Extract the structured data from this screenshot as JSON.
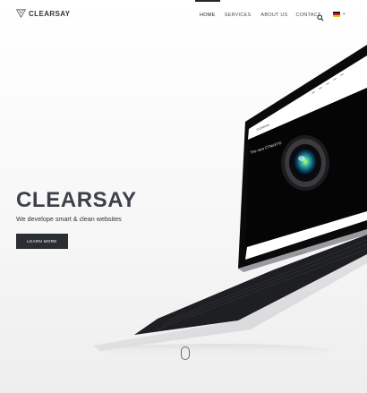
{
  "brand": {
    "name": "CLEARSAY",
    "logo_icon": "triangle-logo-icon"
  },
  "nav": {
    "items": [
      {
        "label": "HOME",
        "active": true
      },
      {
        "label": "SERVICES",
        "active": false
      },
      {
        "label": "ABOUT US",
        "active": false
      },
      {
        "label": "CONTACT",
        "active": false
      }
    ],
    "search_icon": "search-icon",
    "language": {
      "flag": "german-flag-icon",
      "colors": [
        "#1a1a1a",
        "#dd1c1c",
        "#f5c400"
      ],
      "dropdown_icon": "chevron-down-icon"
    }
  },
  "hero": {
    "title": "CLEARSAY",
    "subtitle": "We develope smart & clean websites",
    "cta_label": "LEARN MORE"
  },
  "laptop_screen": {
    "logo": "CLEARSAY",
    "headline": "The new CTNeXT®"
  },
  "scroll_indicator": "mouse-scroll-icon",
  "colors": {
    "text_dark": "#3d4147",
    "button_bg": "#2a2d32",
    "screen_bg": "#050505",
    "lens_accent": "#2aa6a0"
  }
}
